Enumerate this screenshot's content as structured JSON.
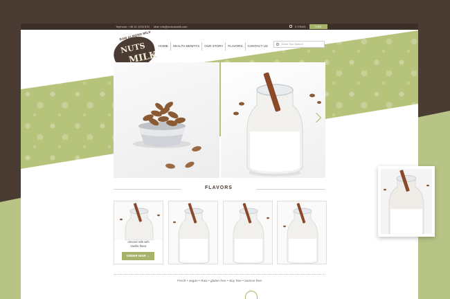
{
  "topbar": {
    "phone": "Telphone: +45 41 1234 678",
    "email": "Mail: info@nutsowmilk.com",
    "cart_items": "0 ITEMS",
    "cart_total": "0 KR"
  },
  "logo": {
    "top_text": "RAW ALMOND MILK",
    "word1": "NUTS",
    "word2": "MILK"
  },
  "nav": {
    "items": [
      "HOME",
      "HEALTH BENFITS",
      "OUR STORY",
      "FLAVORS",
      "CONTACT US"
    ]
  },
  "search": {
    "placeholder": "Enter Your Search"
  },
  "flavors": {
    "title": "FLAVORS",
    "card1_caption_line1": "Almond milk with",
    "card1_caption_line2": "Vanilla flavor",
    "order_label": "ORDER NOW"
  },
  "tagline": "Fresh • vegan • Raw • gluten free • Soy free • lactose free",
  "colors": {
    "brown": "#4a3b33",
    "olive_green": "#b6c37a",
    "accent_green": "#a7b26a",
    "white": "#ffffff"
  },
  "icons": [
    "cart-icon",
    "search-icon",
    "chevron-right-icon",
    "bottle-icon"
  ]
}
